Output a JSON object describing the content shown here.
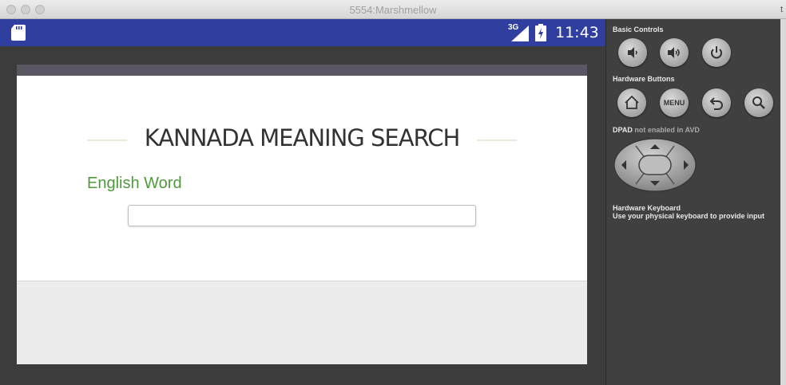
{
  "window": {
    "title": "5554:Marshmellow",
    "edge_char": "t"
  },
  "statusbar": {
    "network": "3G",
    "time": "11:43",
    "color": "#303f9f"
  },
  "app": {
    "title": "KANNADA MEANING SEARCH",
    "input_label": "English Word",
    "input_value": "",
    "label_color": "#4e9a3a"
  },
  "panel": {
    "basic_controls": "Basic Controls",
    "basic_buttons": [
      "volume-down-icon",
      "volume-up-icon",
      "power-icon"
    ],
    "hardware_buttons": "Hardware Buttons",
    "hardware_items": [
      "home-icon",
      "MENU",
      "back-icon",
      "search-icon"
    ],
    "dpad_prefix": "DPAD",
    "dpad_suffix": " not enabled in AVD",
    "keyboard_title": "Hardware Keyboard",
    "keyboard_desc": "Use your physical keyboard to provide input"
  }
}
